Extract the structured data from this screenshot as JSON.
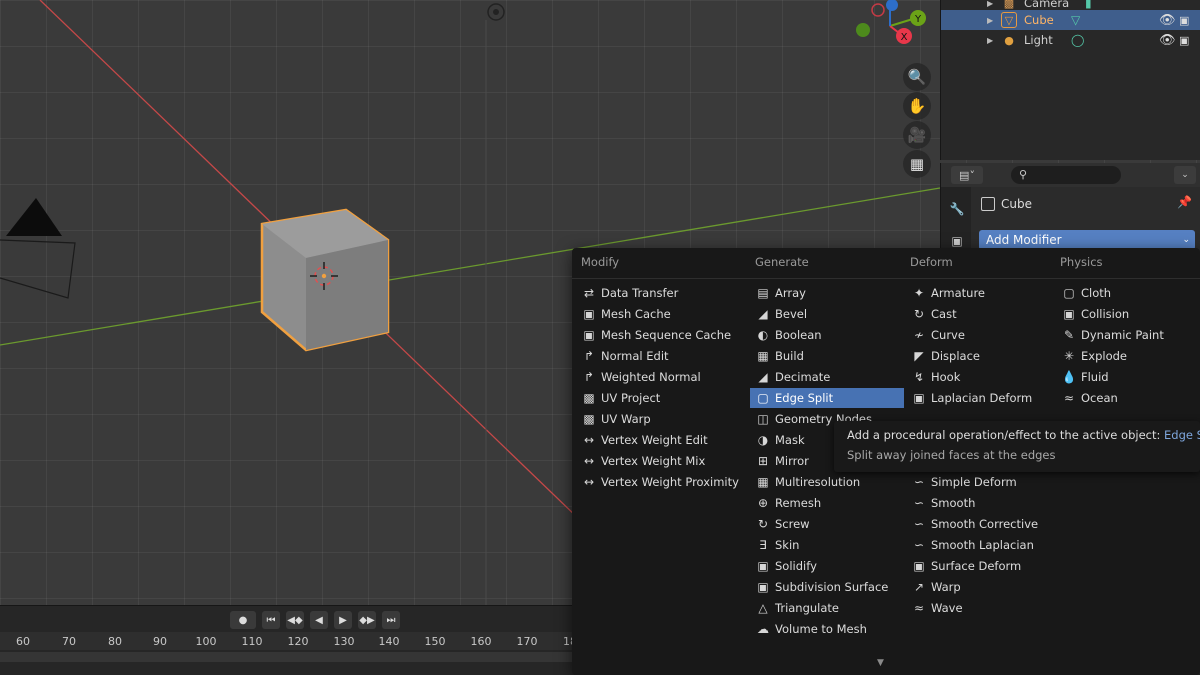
{
  "outliner": {
    "items": [
      {
        "name": "Camera",
        "icon": "camera-object-icon",
        "selected": false
      },
      {
        "name": "Cube",
        "icon": "mesh-object-icon",
        "selected": true
      },
      {
        "name": "Light",
        "icon": "light-object-icon",
        "selected": false
      }
    ]
  },
  "gizmo": {
    "y_label": "Y",
    "x_label": "X",
    "colors": {
      "x": "#e8374a",
      "y": "#6ba317",
      "z": "#2d6ec9"
    }
  },
  "properties": {
    "object_name": "Cube",
    "add_modifier_label": "Add Modifier"
  },
  "timeline": {
    "frame_labels": [
      "60",
      "70",
      "80",
      "90",
      "100",
      "110",
      "120",
      "130",
      "140",
      "150",
      "160",
      "170",
      "18"
    ]
  },
  "menu": {
    "columns": [
      {
        "header": "Modify",
        "items": [
          "Data Transfer",
          "Mesh Cache",
          "Mesh Sequence Cache",
          "Normal Edit",
          "Weighted Normal",
          "UV Project",
          "UV Warp",
          "Vertex Weight Edit",
          "Vertex Weight Mix",
          "Vertex Weight Proximity"
        ]
      },
      {
        "header": "Generate",
        "items": [
          "Array",
          "Bevel",
          "Boolean",
          "Build",
          "Decimate",
          "Edge Split",
          "Geometry Nodes",
          "Mask",
          "Mirror",
          "Multiresolution",
          "Remesh",
          "Screw",
          "Skin",
          "Solidify",
          "Subdivision Surface",
          "Triangulate",
          "Volume to Mesh"
        ]
      },
      {
        "header": "Deform",
        "items": [
          "Armature",
          "Cast",
          "Curve",
          "Displace",
          "Hook",
          "Laplacian Deform",
          "Simple Deform",
          "Smooth",
          "Smooth Corrective",
          "Smooth Laplacian",
          "Surface Deform",
          "Warp",
          "Wave"
        ]
      },
      {
        "header": "Physics",
        "items": [
          "Cloth",
          "Collision",
          "Dynamic Paint",
          "Explode",
          "Fluid",
          "Ocean"
        ]
      }
    ],
    "highlighted": "Edge Split"
  },
  "tooltip": {
    "line1_prefix": "Add a procedural operation/effect to the active object: ",
    "line1_highlight": "Edge Split",
    "line2": "Split away joined faces at the edges"
  }
}
